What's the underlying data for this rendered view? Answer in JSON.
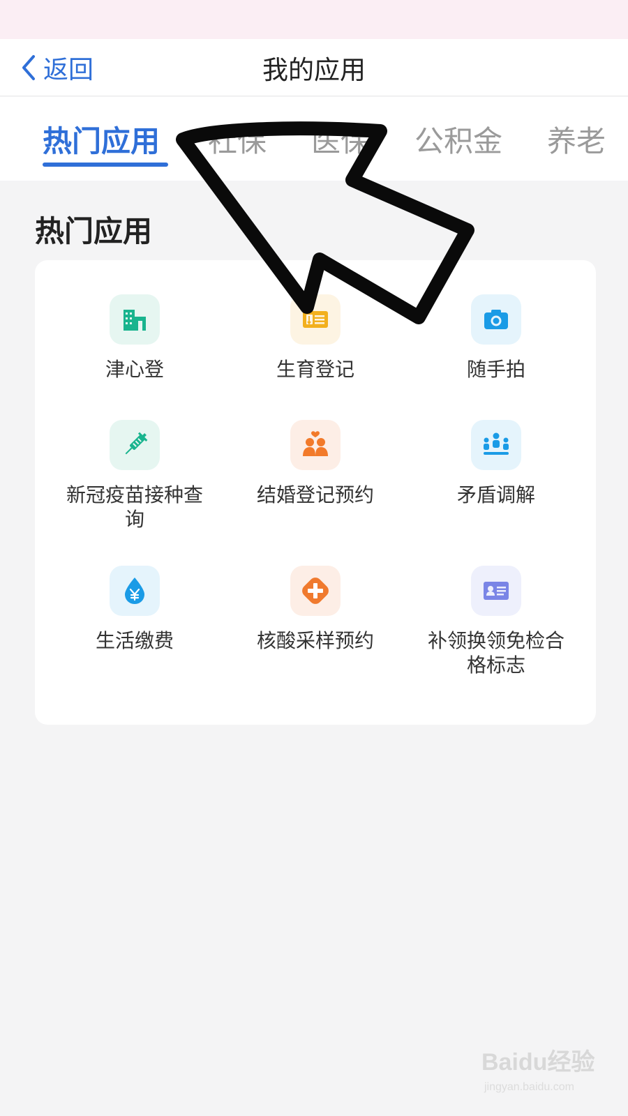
{
  "navbar": {
    "back_label": "返回",
    "title": "我的应用"
  },
  "tabs": [
    {
      "label": "热门应用",
      "active": true
    },
    {
      "label": "社保",
      "active": false
    },
    {
      "label": "医保",
      "active": false
    },
    {
      "label": "公积金",
      "active": false
    },
    {
      "label": "养老",
      "active": false
    }
  ],
  "section": {
    "title": "热门应用"
  },
  "apps": [
    {
      "label": "津心登",
      "icon": "building-icon",
      "bg": "#e6f6f1",
      "color": "#19b48e"
    },
    {
      "label": "生育登记",
      "icon": "id-card-pen-icon",
      "bg": "#fdf4e3",
      "color": "#f2b01e"
    },
    {
      "label": "随手拍",
      "icon": "camera-icon",
      "bg": "#e5f4fc",
      "color": "#1a9be6"
    },
    {
      "label": "新冠疫苗接种查询",
      "icon": "syringe-icon",
      "bg": "#e6f6f1",
      "color": "#19b48e"
    },
    {
      "label": "结婚登记预约",
      "icon": "couple-icon",
      "bg": "#fdeee6",
      "color": "#f27a2a"
    },
    {
      "label": "矛盾调解",
      "icon": "meeting-icon",
      "bg": "#e5f4fc",
      "color": "#1a9be6"
    },
    {
      "label": "生活缴费",
      "icon": "water-drop-yen-icon",
      "bg": "#e5f4fc",
      "color": "#1a9be6"
    },
    {
      "label": "核酸采样预约",
      "icon": "medical-cross-icon",
      "bg": "#fdeee6",
      "color": "#f07a2e"
    },
    {
      "label": "补领换领免检合格标志",
      "icon": "id-card-icon",
      "bg": "#eef0fc",
      "color": "#7a85e6"
    }
  ],
  "watermark": {
    "brand": "Baidu经验",
    "url": "jingyan.baidu.com"
  },
  "colors": {
    "accent": "#2f6fd8",
    "status_strip": "#fbeef4",
    "page_bg": "#f4f4f5"
  }
}
